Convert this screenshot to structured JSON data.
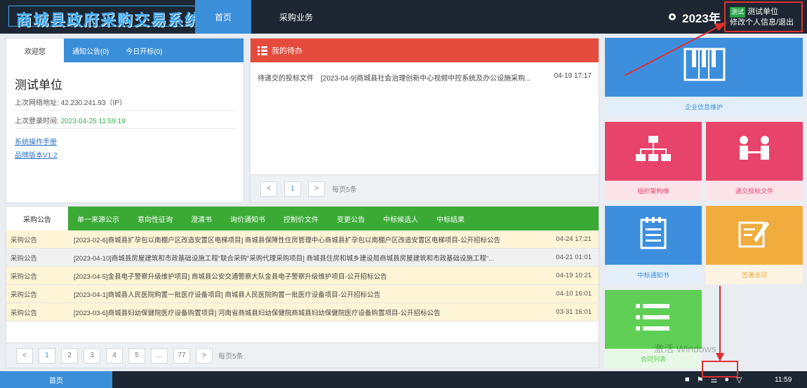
{
  "header": {
    "logo_text": "商城县政府采购交易系统",
    "nav_home": "首页",
    "nav_business": "采购业务",
    "year": "2023年",
    "user_tag": "测试",
    "user_name": "测试单位",
    "user_action": "修改个人信息/退出"
  },
  "welcome": {
    "tabs": [
      "欢迎您",
      "通知公告(0)",
      "今日开标(0)"
    ],
    "unit_name": "测试单位",
    "last_ip_label": "上次网络地址:",
    "last_ip": "42.230.241.93（IP）",
    "last_login_label": "上次登录时间:",
    "last_login": "2023-04-25 11:59:19",
    "links": [
      "系统操作手册",
      "品牌版本V1.2"
    ]
  },
  "todo": {
    "title": "我的待办",
    "item_type": "待递交的投标文件",
    "item_title": "[2023-04-9]商城县社会治理创新中心视频中控系统及办公设施采购...",
    "item_date": "04-19 17:17",
    "page": "1",
    "page_size_text": "每页5条"
  },
  "announcements": {
    "tabs": [
      "采购公告",
      "单一来源公示",
      "意向性征询",
      "澄清书",
      "询价通知书",
      "控制价文件",
      "变更公告",
      "中标候选人",
      "中标结果"
    ],
    "rows": [
      {
        "cat": "采购公告",
        "title": "[2023-02-6]商城县扩孕包以南棚户区改造安置区电梯项目] 商城县保障性住房管理中心商城县扩孕包以南棚户区改造安置区电梯项目-公开招标公告",
        "date": "04-24 17:21",
        "style": "y"
      },
      {
        "cat": "采购公告",
        "title": "[2023-04-10]商城县房屋建筑和市政基础设施工程“联合采购”采购代理采购项目] 商城县住房和城乡建设局商城县房屋建筑和市政基础设施工程“...",
        "date": "04-21 01:01",
        "style": "g"
      },
      {
        "cat": "采购公告",
        "title": "[2023-04-5]金县电子警察升级维护项目] 商城县公安交通警察大队金县电子警察升级维护项目-公开招标公告",
        "date": "04-19 10:21",
        "style": "y"
      },
      {
        "cat": "采购公告",
        "title": "[2023-04-1]商城县人民医院购置一批医疗设备项目] 商城县人民医院购置一批医疗设备项目-公开招标公告",
        "date": "04-10 16:01",
        "style": "y"
      },
      {
        "cat": "采购公告",
        "title": "[2023-03-6]商城县妇幼保健院医疗设备购置项目] 河南省商城县妇幼保健院商城县妇幼保健院医疗设备购置项目-公开招标公告",
        "date": "03-31 16:01",
        "style": "y"
      }
    ],
    "pages": [
      "1",
      "2",
      "3",
      "4",
      "5",
      "...",
      "77"
    ],
    "page_size_text": "每页5条"
  },
  "tiles": {
    "info": "企业信息维护",
    "org": "组织架构维",
    "submit": "递交投标文件",
    "notice": "中标通知书",
    "contract": "签署合同",
    "list": "合同列表"
  },
  "watermark": "激活 Windows",
  "footer": {
    "home": "首页",
    "clock": "11:59"
  },
  "colors": {
    "topbar": "#1d2733",
    "accent_blue": "#3b8fd9",
    "todo_red": "#e54b3c",
    "ann_green": "#3aaa35",
    "tile_pink": "#e8436a",
    "tile_orange": "#f0ad3e",
    "tile_green": "#5fcf56",
    "highlight_red": "#e0302e"
  }
}
